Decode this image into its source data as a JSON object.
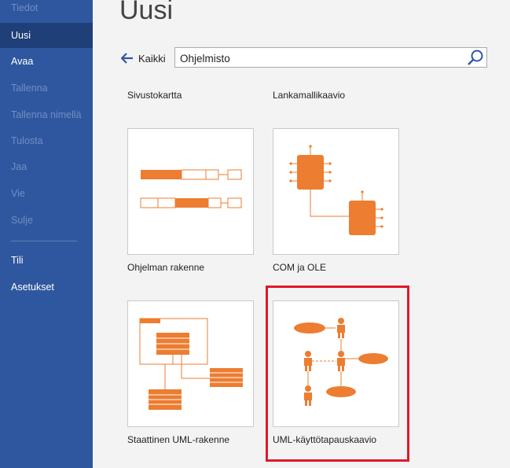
{
  "sidebar": {
    "items": [
      {
        "label": "Tiedot",
        "state": "dim"
      },
      {
        "label": "Uusi",
        "state": "active"
      },
      {
        "label": "Avaa",
        "state": "normal"
      },
      {
        "label": "Tallenna",
        "state": "dim"
      },
      {
        "label": "Tallenna nimellä",
        "state": "dim"
      },
      {
        "label": "Tulosta",
        "state": "dim"
      },
      {
        "label": "Jaa",
        "state": "dim"
      },
      {
        "label": "Vie",
        "state": "dim"
      },
      {
        "label": "Sulje",
        "state": "dim"
      },
      {
        "label": "Tili",
        "state": "normal"
      },
      {
        "label": "Asetukset",
        "state": "normal"
      }
    ]
  },
  "main": {
    "title": "Uusi",
    "back_label": "Kaikki",
    "search": {
      "value": "Ohjelmisto",
      "placeholder": ""
    },
    "categories": [
      "Sivustokartta",
      "Lankamallikaavio"
    ],
    "templates": [
      {
        "label": "Ohjelman rakenne",
        "icon": "program-structure-thumbnail"
      },
      {
        "label": "COM ja OLE",
        "icon": "com-ole-thumbnail"
      },
      {
        "label": "Staattinen UML-rakenne",
        "icon": "uml-static-structure-thumbnail"
      },
      {
        "label": "UML-käyttötapauskaavio",
        "icon": "uml-use-case-thumbnail",
        "selected": true
      }
    ]
  },
  "colors": {
    "sidebar_bg": "#2f579f",
    "sidebar_active": "#1e3f78",
    "accent_orange": "#ed7d31",
    "highlight_red": "#e0192a"
  }
}
